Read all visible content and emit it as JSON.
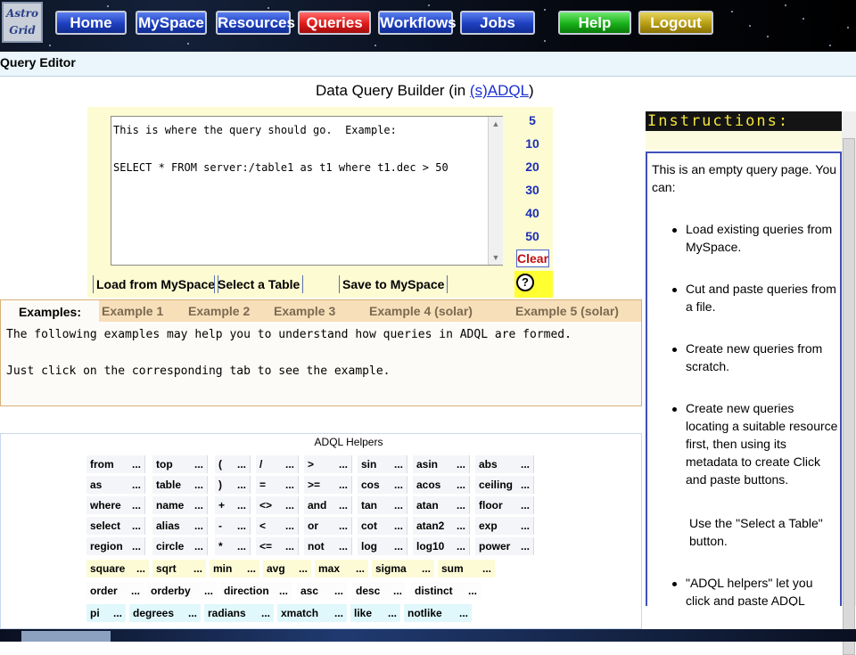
{
  "logo": {
    "line1": "Astro",
    "line2": "Grid"
  },
  "nav": [
    {
      "label": "Home",
      "style": "blue"
    },
    {
      "label": "MySpace",
      "style": "blue"
    },
    {
      "label": "Resources",
      "style": "blue"
    },
    {
      "label": "Queries",
      "style": "red"
    },
    {
      "label": "Workflows",
      "style": "blue"
    },
    {
      "label": "Jobs",
      "style": "blue"
    },
    {
      "label": "Help",
      "style": "green"
    },
    {
      "label": "Logout",
      "style": "gold"
    }
  ],
  "page": {
    "section_title": "Query Editor",
    "builder_title_prefix": "Data Query Builder (in ",
    "builder_title_link": "(s)ADQL",
    "builder_title_suffix": ")"
  },
  "query": {
    "value": "This is where the query should go.  Example:\n\nSELECT * FROM server:/table1 as t1 where t1.dec > 50"
  },
  "row_counts": [
    "5",
    "10",
    "20",
    "30",
    "40",
    "50"
  ],
  "clear_label": "Clear",
  "help_icon_label": "?",
  "query_buttons": {
    "load": "Load from MySpace",
    "select": "Select a Table",
    "save": "Save to MySpace"
  },
  "examples": {
    "label": "Examples:",
    "tabs": [
      "Example 1",
      "Example 2",
      "Example 3",
      "Example 4 (solar)",
      "Example 5 (solar)"
    ],
    "line1": "The following examples may help you to understand how queries in ADQL are formed.",
    "line2": " Just click on the corresponding tab to see the example."
  },
  "helpers": {
    "title": "ADQL Helpers",
    "dots": "...",
    "rows": [
      {
        "tone": "gray",
        "items": [
          "from",
          "top",
          "(",
          "/",
          ">",
          "sin",
          "asin",
          "abs"
        ]
      },
      {
        "tone": "gray",
        "items": [
          "as",
          "table",
          ")",
          "=",
          ">=",
          "cos",
          "acos",
          "ceiling"
        ]
      },
      {
        "tone": "gray",
        "items": [
          "where",
          "name",
          "+",
          "<>",
          "and",
          "tan",
          "atan",
          "floor"
        ]
      },
      {
        "tone": "gray",
        "items": [
          "select",
          "alias",
          "-",
          "<",
          "or",
          "cot",
          "atan2",
          "exp"
        ]
      },
      {
        "tone": "gray",
        "items": [
          "region",
          "circle",
          "*",
          "<=",
          "not",
          "log",
          "log10",
          "power"
        ]
      },
      {
        "tone": "yellow",
        "items": [
          "square",
          "sqrt",
          "min",
          "avg",
          "max",
          "sigma",
          "sum"
        ]
      },
      {
        "tone": "white",
        "items": [
          "order",
          "orderby",
          "direction",
          "asc",
          "desc",
          "distinct"
        ]
      },
      {
        "tone": "cyan",
        "items": [
          "pi",
          "degrees",
          "radians",
          "xmatch",
          "like",
          "notlike"
        ]
      }
    ]
  },
  "instructions": {
    "title": "Instructions:",
    "intro": "This is an empty query page. You can:",
    "bullets": [
      "Load existing queries from MySpace.",
      "Cut and paste queries from a file.",
      "Create new queries from scratch.",
      "Create new queries locating a suitable resource first, then using its metadata to create Click and paste buttons."
    ],
    "note": "Use the \"Select a Table\" button.",
    "last_bullet": "\"ADQL helpers\" let you click and paste ADQL keywords"
  },
  "colors": {
    "accent_link": "#1a2fd0",
    "row_count": "#1b2fb8",
    "clear": "#c01010",
    "instructions_title": "#f3e43a"
  }
}
